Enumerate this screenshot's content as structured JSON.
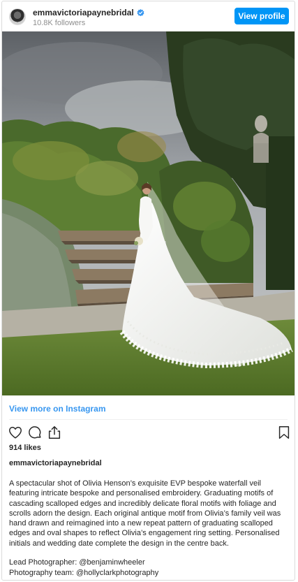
{
  "header": {
    "username": "emmavictoriapaynebridal",
    "followers": "10.8K followers",
    "view_profile_label": "View profile"
  },
  "post": {
    "image_alt": "bride in veil on garden steps",
    "view_more_label": "View more on Instagram",
    "likes": "914 likes",
    "caption_username": "emmavictoriapaynebridal",
    "caption": "A spectacular shot of Olivia Henson’s exquisite EVP bespoke waterfall veil featuring intricate bespoke and personalised embroidery. Graduating motifs of cascading scalloped edges and incredibly delicate floral motifs with foliage and scrolls adorn the design. Each original antique motif from Olivia’s family veil was hand drawn and reimagined into a new repeat pattern of graduating scalloped edges and oval shapes to reflect Olivia’s engagement ring setting. Personalised initials and wedding date complete the design in the centre back.",
    "credits": [
      {
        "label": "Lead Photographer: ",
        "handle": "@benjaminwheeler"
      },
      {
        "label": "Photography team: ",
        "handle": "@hollyclarkphotography"
      }
    ]
  },
  "icons": [
    "avatar",
    "verified-badge-icon",
    "heart-icon",
    "comment-icon",
    "share-icon",
    "bookmark-icon"
  ],
  "colors": {
    "accent": "#0095f6",
    "link": "#3897f0",
    "text": "#262626",
    "muted": "#8e8e8e",
    "border": "#dbdbdb"
  }
}
